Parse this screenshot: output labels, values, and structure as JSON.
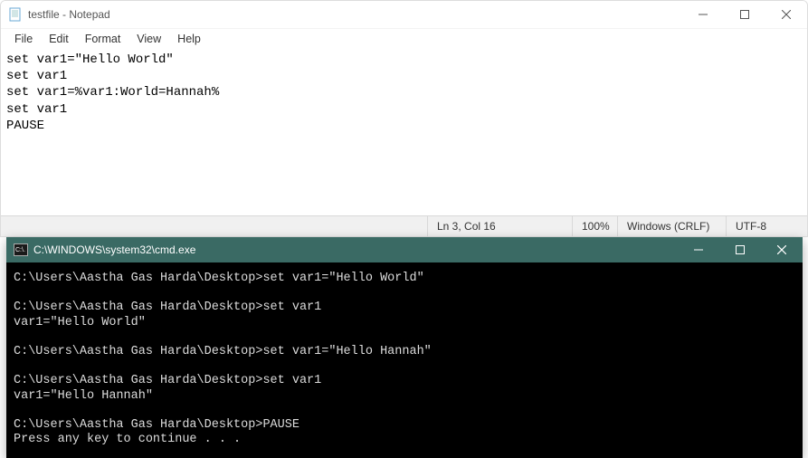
{
  "notepad": {
    "title": "testfile - Notepad",
    "menu": {
      "file": "File",
      "edit": "Edit",
      "format": "Format",
      "view": "View",
      "help": "Help"
    },
    "content": "set var1=\"Hello World\"\nset var1\nset var1=%var1:World=Hannah%\nset var1\nPAUSE",
    "status": {
      "position": "Ln 3, Col 16",
      "zoom": "100%",
      "lineending": "Windows (CRLF)",
      "encoding": "UTF-8"
    }
  },
  "cmd": {
    "title": "C:\\WINDOWS\\system32\\cmd.exe",
    "icon_text": "C:\\.",
    "content": "C:\\Users\\Aastha Gas Harda\\Desktop>set var1=\"Hello World\"\n\nC:\\Users\\Aastha Gas Harda\\Desktop>set var1\nvar1=\"Hello World\"\n\nC:\\Users\\Aastha Gas Harda\\Desktop>set var1=\"Hello Hannah\"\n\nC:\\Users\\Aastha Gas Harda\\Desktop>set var1\nvar1=\"Hello Hannah\"\n\nC:\\Users\\Aastha Gas Harda\\Desktop>PAUSE\nPress any key to continue . . ."
  }
}
